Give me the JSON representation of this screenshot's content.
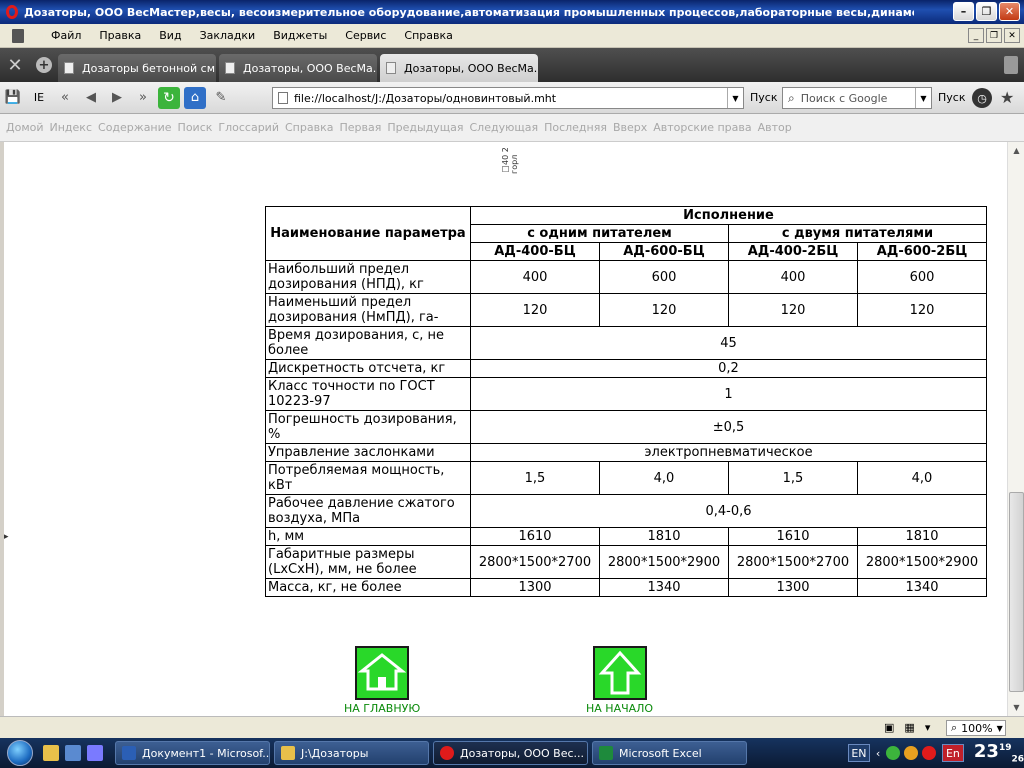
{
  "window": {
    "title": "Дозаторы, ООО ВесМастер,весы, весоизмерительное оборудование,автоматизация промышленных процессов,лабораторные весы,динамоме... - [ OPERA..."
  },
  "menu": [
    "Файл",
    "Правка",
    "Вид",
    "Закладки",
    "Виджеты",
    "Сервис",
    "Справка"
  ],
  "tabs": [
    {
      "label": "Дозаторы бетонной см..."
    },
    {
      "label": "Дозаторы, ООО ВесМа..."
    },
    {
      "label": "Дозаторы, ООО ВесМа..."
    }
  ],
  "toolbar": {
    "ie_label": "IE",
    "url": "file://localhost/J:/Дозаторы/одновинтовый.mht",
    "go_label": "Пуск",
    "search_placeholder": "Поиск с Google",
    "search_go_label": "Пуск"
  },
  "navlinks": [
    "Домой",
    "Индекс",
    "Содержание",
    "Поиск",
    "Глоссарий",
    "Справка",
    "Первая",
    "Предыдущая",
    "Следующая",
    "Последняя",
    "Вверх",
    "Авторские права",
    "Автор"
  ],
  "drawing_label": "□40 2 горл",
  "table": {
    "header_param": "Наименование параметра",
    "header_exec": "Исполнение",
    "group1": "с одним питателем",
    "group2": "с двумя питателями",
    "models": [
      "АД-400-БЦ",
      "АД-600-БЦ",
      "АД-400-2БЦ",
      "АД-600-2БЦ"
    ],
    "rows": [
      {
        "name": "Наибольший предел дозирования (НПД), кг",
        "values": [
          "400",
          "600",
          "400",
          "600"
        ]
      },
      {
        "name": "Наименьший предел дозирования (НмПД), га-",
        "values": [
          "120",
          "120",
          "120",
          "120"
        ]
      },
      {
        "name": "Время дозирования, с, не более",
        "span": "45"
      },
      {
        "name": "Дискретность отсчета, кг",
        "span": "0,2"
      },
      {
        "name": "Класс точности по ГОСТ 10223-97",
        "span": "1"
      },
      {
        "name": "Погрешность дозирования, %",
        "span": "±0,5"
      },
      {
        "name": "Управление заслонками",
        "span": "электропневматическое"
      },
      {
        "name": "Потребляемая мощность, кВт",
        "values": [
          "1,5",
          "4,0",
          "1,5",
          "4,0"
        ]
      },
      {
        "name": "Рабочее давление сжатого воздуха, МПа",
        "span": "0,4-0,6"
      },
      {
        "name": "h, мм",
        "values": [
          "1610",
          "1810",
          "1610",
          "1810"
        ]
      },
      {
        "name": "Габаритные размеры (LxCxH), мм, не более",
        "values": [
          "2800*1500*2700",
          "2800*1500*2900",
          "2800*1500*2700",
          "2800*1500*2900"
        ]
      },
      {
        "name": "Масса, кг, не более",
        "values": [
          "1300",
          "1340",
          "1300",
          "1340"
        ]
      }
    ]
  },
  "buttons": {
    "home_label": "НА ГЛАВНУЮ",
    "top_label": "НА НАЧАЛО"
  },
  "status": {
    "zoom": "100%"
  },
  "taskbar": {
    "tasks": [
      {
        "label": "Документ1 - Microsof...",
        "color": "#2b5fb5"
      },
      {
        "label": "J:\\Дозаторы",
        "color": "#e8c04a"
      },
      {
        "label": "Дозаторы, ООО Вес...",
        "color": "#e01b1b"
      },
      {
        "label": "Microsoft Excel",
        "color": "#1e8a3c"
      }
    ],
    "lang": "EN",
    "lang2": "En",
    "time_hour": "23",
    "time_min": "19",
    "time_sec": "26"
  },
  "colors": {
    "accent_green": "#29d829",
    "link_green": "#0a8a0a"
  }
}
